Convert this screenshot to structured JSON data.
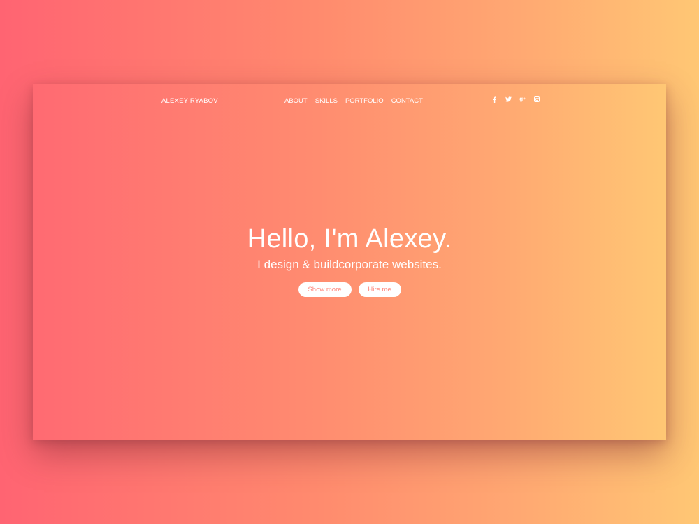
{
  "nav": {
    "brand": "ALEXEY RYABOV",
    "menu": [
      {
        "label": "ABOUT"
      },
      {
        "label": "SKILLS"
      },
      {
        "label": "PORTFOLIO"
      },
      {
        "label": "CONTACT"
      }
    ],
    "social": [
      {
        "icon": "facebook-icon",
        "glyph": "f"
      },
      {
        "icon": "twitter-icon",
        "glyph": "t"
      },
      {
        "icon": "google-plus-icon",
        "glyph": "g+"
      },
      {
        "icon": "instagram-icon",
        "glyph": "◘"
      }
    ]
  },
  "hero": {
    "title": "Hello, I'm Alexey.",
    "subtitle": "I design & buildcorporate websites.",
    "buttons": {
      "show_more": "Show more",
      "hire_me": "Hire me"
    }
  },
  "colors": {
    "gradient_start": "#ff6472",
    "gradient_end": "#ffc774",
    "button_text": "#ff8479"
  }
}
